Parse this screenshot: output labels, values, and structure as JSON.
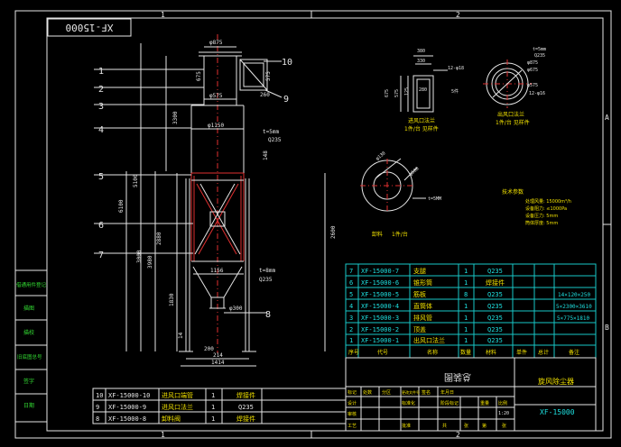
{
  "drawing_number_box": "XF-15000",
  "frame_zone_top": [
    "1",
    "2"
  ],
  "frame_zone_right": [
    "A",
    "B"
  ],
  "part_balloons": [
    "1",
    "2",
    "3",
    "4",
    "5",
    "6",
    "7",
    "8",
    "9",
    "10"
  ],
  "main_dims": {
    "d_top": "φ875",
    "d_outlet": "φ575",
    "d_body": "φ1150",
    "d_bottom": "φ300",
    "h_1200": "1200",
    "h_3300": "3300",
    "h_148": "148",
    "h_5100": "5100",
    "h_6100": "6100",
    "h_2880": "2880",
    "h_3000": "3000",
    "h_3980": "3980",
    "h_2600": "2600",
    "h_1830": "1830",
    "h_14": "14",
    "w_1156": "1156",
    "w_200": "200",
    "w_214": "214",
    "w_1414": "1414",
    "h_675": "675",
    "h_575": "575",
    "w_260": "260",
    "t_5mm_a": "t=5mm",
    "mat_a": "Q235",
    "t_8mm": "t=8mm",
    "mat_b": "Q235"
  },
  "inlet_flange": {
    "w380": "380",
    "w330": "330",
    "w280": "280",
    "h675": "675",
    "h575": "575",
    "h125": "125",
    "holes": "12-φ18",
    "thick": "5件",
    "title": "进风口法兰",
    "qty": "1件/台 见样件"
  },
  "outlet_flange": {
    "t": "t=5mm",
    "mat": "Q235",
    "d875": "φ875",
    "d675": "φ675",
    "d575": "φ575",
    "holes": "12-φ16",
    "title": "出风口法兰",
    "qty": "1件/台 见样件"
  },
  "bottom_flange": {
    "d130": "φ130",
    "d580": "φ580",
    "t": "t=5MM",
    "title": "卸料",
    "qty": "1件/台"
  },
  "tech_req": {
    "title": "技术参数",
    "lines": [
      "处理风量: 15000m³/h",
      "设备阻力: ≤1000Pa",
      "设备压力: 5mm",
      "筒体厚度: 5mm"
    ]
  },
  "bom": {
    "rows": [
      {
        "no": "7",
        "code": "XF-15000-7",
        "name": "支腿",
        "qty": "1",
        "mat": "Q235",
        "note": ""
      },
      {
        "no": "6",
        "code": "XF-15000-6",
        "name": "锥形筒",
        "qty": "1",
        "mat": "焊接件",
        "note": ""
      },
      {
        "no": "5",
        "code": "XF-15000-5",
        "name": "筋板",
        "qty": "8",
        "mat": "Q235",
        "note": "14×120×250"
      },
      {
        "no": "4",
        "code": "XF-15000-4",
        "name": "直筒体",
        "qty": "1",
        "mat": "Q235",
        "note": "5×2300×3610"
      },
      {
        "no": "3",
        "code": "XF-15000-3",
        "name": "排风管",
        "qty": "1",
        "mat": "Q235",
        "note": "5×775×1810"
      },
      {
        "no": "2",
        "code": "XF-15000-2",
        "name": "顶盖",
        "qty": "1",
        "mat": "Q235",
        "note": ""
      },
      {
        "no": "1",
        "code": "XF-15000-1",
        "name": "出风口法兰",
        "qty": "1",
        "mat": "Q235",
        "note": ""
      }
    ],
    "header": [
      "序号",
      "代号",
      "名称",
      "数量",
      "材料",
      "单件",
      "总计",
      "备注"
    ],
    "extra_rows": [
      {
        "no": "10",
        "code": "XF-15000-10",
        "name": "进风口端管",
        "qty": "1",
        "mat": "焊接件"
      },
      {
        "no": "9",
        "code": "XF-15000-9",
        "name": "进风口法兰",
        "qty": "1",
        "mat": "Q235"
      },
      {
        "no": "8",
        "code": "XF-15000-8",
        "name": "卸料阀",
        "qty": "1",
        "mat": "焊接件"
      }
    ]
  },
  "title_block": {
    "drawing_title": "总装图",
    "product": "旋风除尘器",
    "code": "XF-15000",
    "scale": "1:20",
    "small_labels": [
      "标记",
      "处数",
      "分区",
      "更改文件号",
      "签名",
      "年月日",
      "设计",
      "标准化",
      "阶段标记",
      "重量",
      "比例",
      "审核",
      "工艺",
      "批准",
      "共",
      "张",
      "第",
      "张"
    ]
  },
  "side_block": [
    "借通用件登记",
    "描图",
    "描校",
    "旧底图总号",
    "签字",
    "日期"
  ]
}
